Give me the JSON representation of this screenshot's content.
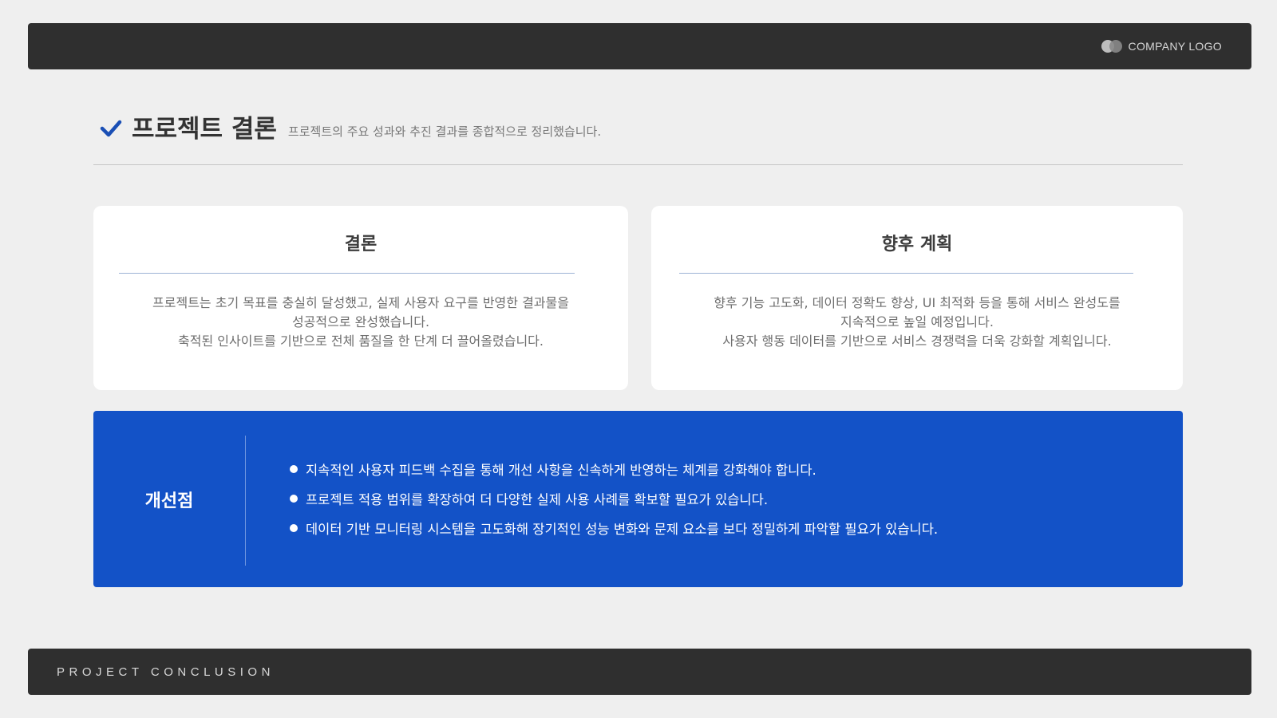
{
  "header": {
    "logo_text": "COMPANY LOGO",
    "logo_icon": "two-overlapping-circles-icon"
  },
  "title": {
    "icon": "check-icon",
    "text": "프로젝트 결론",
    "subtitle": "프로젝트의 주요 성과와 추진 결과를 종합적으로 정리했습니다."
  },
  "cards": [
    {
      "title": "결론",
      "lines": [
        "프로젝트는 초기 목표를 충실히 달성했고, 실제 사용자 요구를 반영한 결과물을",
        "성공적으로 완성했습니다.",
        "축적된 인사이트를 기반으로 전체 품질을 한 단계 더 끌어올렸습니다."
      ]
    },
    {
      "title": "향후 계획",
      "lines": [
        "향후 기능 고도화, 데이터 정확도 향상, UI 최적화 등을 통해 서비스 완성도를",
        "지속적으로 높일 예정입니다.",
        "사용자 행동 데이터를 기반으로 서비스 경쟁력을 더욱 강화할 계획입니다."
      ]
    }
  ],
  "improvements": {
    "title": "개선점",
    "items": [
      "지속적인 사용자 피드백 수집을 통해 개선 사항을 신속하게 반영하는 체계를 강화해야 합니다.",
      "프로젝트 적용 범위를 확장하여 더 다양한 실제 사용 사례를 확보할 필요가 있습니다.",
      "데이터 기반 모니터링 시스템을 고도화해 장기적인 성능 변화와 문제 요소를 보다 정밀하게 파악할 필요가 있습니다."
    ]
  },
  "footer": {
    "text": "PROJECT CONCLUSION"
  },
  "colors": {
    "dark_bar": "#2f2f2f",
    "accent_blue": "#1352c7",
    "background": "#efefef"
  }
}
